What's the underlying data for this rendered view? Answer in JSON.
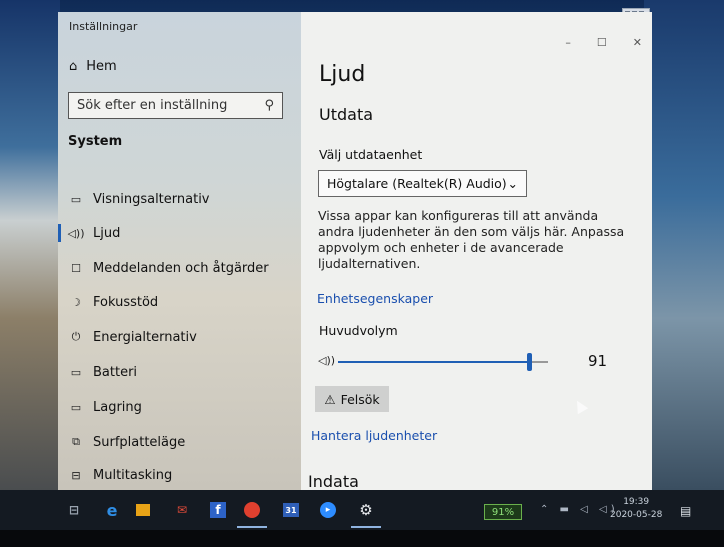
{
  "window": {
    "title": "Inställningar",
    "minimize": "–",
    "maximize": "☐",
    "close": "✕"
  },
  "sidebar": {
    "home": "Hem",
    "search_placeholder": "Sök efter en inställning",
    "section": "System",
    "items": [
      {
        "label": "Visningsalternativ",
        "icon": "monitor-icon",
        "glyph": "▭"
      },
      {
        "label": "Ljud",
        "icon": "speaker-icon",
        "glyph": "🔈"
      },
      {
        "label": "Meddelanden och åtgärder",
        "icon": "message-icon",
        "glyph": "☐"
      },
      {
        "label": "Fokusstöd",
        "icon": "moon-icon",
        "glyph": "☽"
      },
      {
        "label": "Energialternativ",
        "icon": "power-icon",
        "glyph": "⏻"
      },
      {
        "label": "Batteri",
        "icon": "battery-icon",
        "glyph": "▭"
      },
      {
        "label": "Lagring",
        "icon": "storage-icon",
        "glyph": "▭"
      },
      {
        "label": "Surfplatteläge",
        "icon": "tablet-icon",
        "glyph": "⧉"
      },
      {
        "label": "Multitasking",
        "icon": "multitask-icon",
        "glyph": "⊟"
      }
    ]
  },
  "content": {
    "title": "Ljud",
    "output_heading": "Utdata",
    "output_device_label": "Välj utdataenhet",
    "output_device_value": "Högtalare (Realtek(R) Audio)",
    "description": "Vissa appar kan konfigureras till att använda andra ljudenheter än den som väljs här. Anpassa appvolym och enheter i de avancerade ljudalternativen.",
    "device_properties_link": "Enhetsegenskaper",
    "master_volume_label": "Huvudvolym",
    "volume_value": "91",
    "volume_level": 0.91,
    "troubleshoot_button": "Felsök",
    "manage_devices_link": "Hantera ljudenheter",
    "input_heading": "Indata"
  },
  "taskbar": {
    "battery": "91%",
    "time": "19:39",
    "date": "2020-05-28"
  },
  "colors": {
    "accent": "#1f5fb5",
    "link": "#1a4fae"
  }
}
